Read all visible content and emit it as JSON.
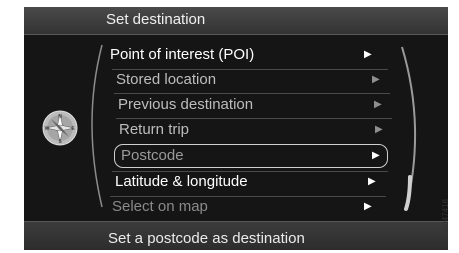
{
  "header": {
    "title": "Set destination"
  },
  "menu": {
    "items": [
      {
        "label": "Point of interest (POI)",
        "arrow": "▶"
      },
      {
        "label": "Stored location",
        "arrow": "▶"
      },
      {
        "label": "Previous destination",
        "arrow": "▶"
      },
      {
        "label": "Return trip",
        "arrow": "▶"
      },
      {
        "label": "Postcode",
        "arrow": "▶"
      },
      {
        "label": "Latitude & longitude",
        "arrow": "▶"
      },
      {
        "label": "Select on map",
        "arrow": "▶"
      }
    ]
  },
  "compass": {
    "icon": "compass-icon",
    "n": "N",
    "s": "S",
    "e": "E",
    "w": "W"
  },
  "footer": {
    "hint": "Set a postcode as destination"
  },
  "side_code": "G047418",
  "colors": {
    "screen_bg": "#151515",
    "header_bg": "#3c3c3c",
    "text_bright": "#ffffff",
    "text_dim": "#bdbdbd",
    "text_faded": "#8a8a8a",
    "highlight_border": "#cfcfcf"
  }
}
